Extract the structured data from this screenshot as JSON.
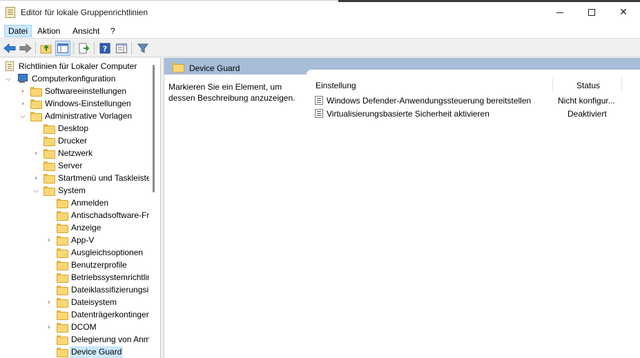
{
  "window": {
    "title": "Editor für lokale Gruppenrichtlinien",
    "controls": [
      "minimize",
      "maximize",
      "close"
    ]
  },
  "menu": {
    "items": [
      "Datei",
      "Aktion",
      "Ansicht",
      "?"
    ],
    "active": "Datei"
  },
  "toolbar": {
    "icons": [
      "back-arrow-icon",
      "forward-arrow-icon",
      "up-folder-icon",
      "show-hide-tree-icon",
      "export-list-icon",
      "help-icon",
      "properties-pane-icon",
      "filter-icon"
    ]
  },
  "tree": {
    "root": "Richtlinien für Lokaler Computer",
    "computer": "Computerkonfiguration",
    "software": "Softwareeinstellungen",
    "windows": "Windows-Einstellungen",
    "admin": "Administrative Vorlagen",
    "desktop": "Desktop",
    "drucker": "Drucker",
    "netzwerk": "Netzwerk",
    "server": "Server",
    "startmenu": "Startmenü und Taskleiste",
    "system": "System",
    "anmelden": "Anmelden",
    "antischad": "Antischadsoftware-Frühstart",
    "anzeige": "Anzeige",
    "appv": "App-V",
    "ausgleich": "Ausgleichsoptionen",
    "benutzer": "Benutzerprofile",
    "betriebs": "Betriebssystemrichtlinien",
    "dateiklass": "Dateiklassifizierungsinfrastruktur",
    "dateisystem": "Dateisystem",
    "datentraeger": "Datenträgerkontingente",
    "dcom": "DCOM",
    "delegierung": "Delegierung von Anmeldeinformationen",
    "deviceguard": "Device Guard"
  },
  "details": {
    "header_title": "Device Guard",
    "description": "Markieren Sie ein Element, um dessen Beschreibung anzuzeigen.",
    "columns": {
      "setting": "Einstellung",
      "status": "Status"
    },
    "rows": [
      {
        "name": "Windows Defender-Anwendungssteuerung bereitstellen",
        "status": "Nicht konfigur..."
      },
      {
        "name": "Virtualisierungsbasierte Sicherheit aktivieren",
        "status": "Deaktiviert"
      }
    ]
  },
  "colors": {
    "selection": "#cce8ff",
    "header_band": "#a8bdd8",
    "folder": "#f8d775"
  }
}
